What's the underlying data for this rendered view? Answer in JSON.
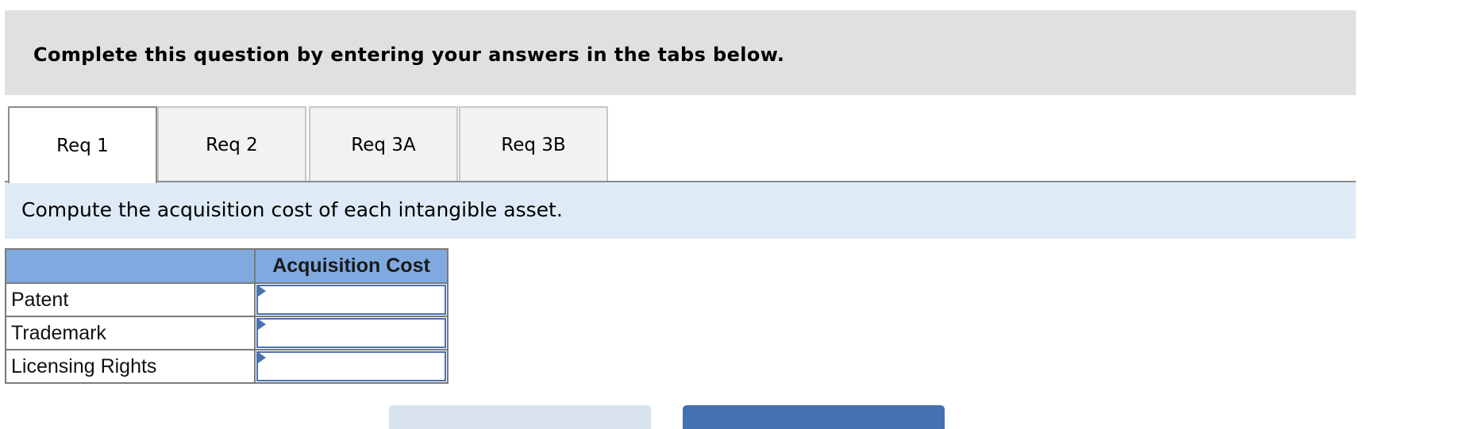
{
  "header": {
    "instruction": "Complete this question by entering your answers in the tabs below."
  },
  "tabs": [
    {
      "label": "Req 1",
      "active": true
    },
    {
      "label": "Req 2",
      "active": false
    },
    {
      "label": "Req 3A",
      "active": false
    },
    {
      "label": "Req 3B",
      "active": false
    }
  ],
  "prompt": "Compute the acquisition cost of each intangible asset.",
  "table": {
    "columns": [
      "",
      "Acquisition Cost"
    ],
    "rows": [
      {
        "label": "Patent",
        "value": ""
      },
      {
        "label": "Trademark",
        "value": ""
      },
      {
        "label": "Licensing Rights",
        "value": ""
      }
    ]
  },
  "buttons": {
    "prev_label": "",
    "next_label": ""
  },
  "colors": {
    "header_bg": "#e0e0e0",
    "instruction_bg": "#deebf7",
    "table_header_bg": "#80aadf",
    "input_border": "#4a72b0",
    "next_button": "#4472b1",
    "prev_button": "#d9e3f0"
  }
}
